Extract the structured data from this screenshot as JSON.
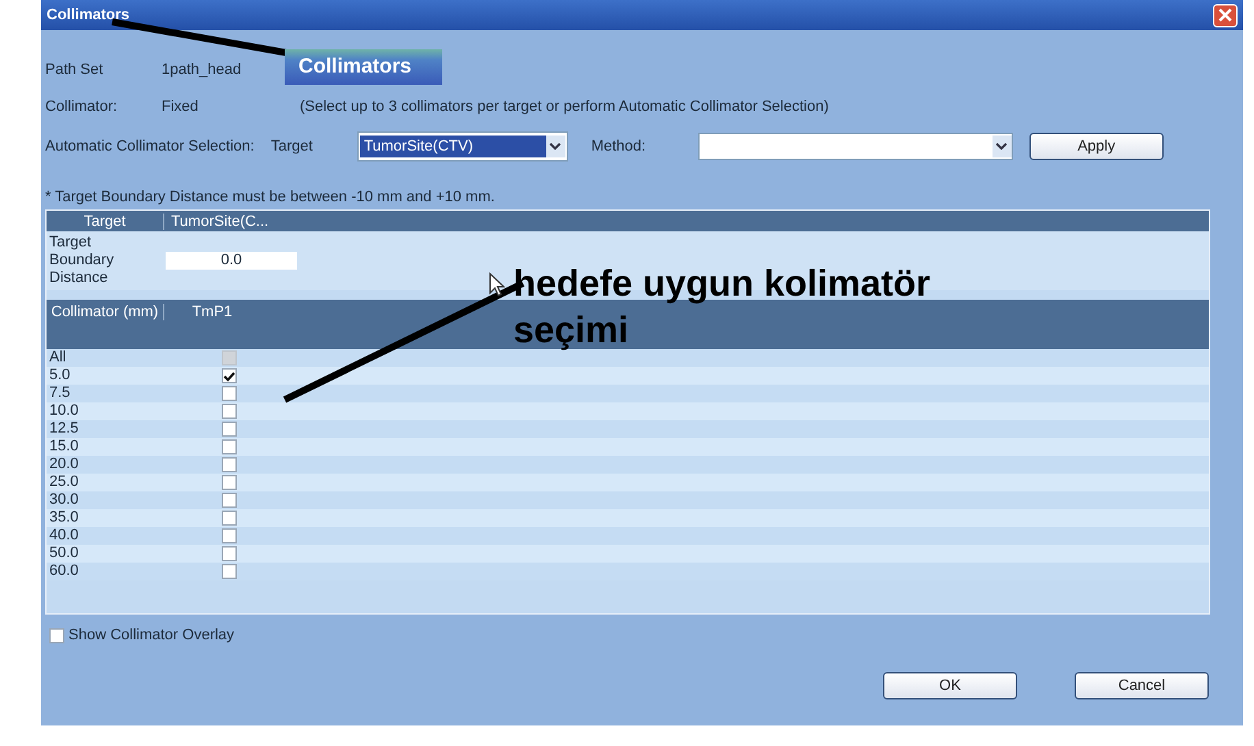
{
  "window": {
    "title": "Collimators"
  },
  "callout_label": "Collimators",
  "path_set": {
    "label": "Path Set",
    "value": "1path_head"
  },
  "collimator": {
    "label": "Collimator:",
    "value": "Fixed",
    "hint": "(Select up to 3 collimators per target or perform Automatic Collimator Selection)"
  },
  "auto_selection": {
    "label": "Automatic Collimator Selection:",
    "target_label": "Target",
    "target_value": "TumorSite(CTV)",
    "method_label": "Method:",
    "apply": "Apply"
  },
  "note": "* Target Boundary Distance must be between -10 mm and +10 mm.",
  "target_table": {
    "columns": [
      "Target",
      "TumorSite(C..."
    ],
    "row_label": "Target Boundary Distance",
    "value": "0.0"
  },
  "collimator_table": {
    "columns": [
      "Collimator (mm)",
      "TmP1"
    ],
    "rows": [
      {
        "size": "All",
        "checked": false,
        "disabled": true
      },
      {
        "size": "5.0",
        "checked": true,
        "disabled": false
      },
      {
        "size": "7.5",
        "checked": false,
        "disabled": false
      },
      {
        "size": "10.0",
        "checked": false,
        "disabled": false
      },
      {
        "size": "12.5",
        "checked": false,
        "disabled": false
      },
      {
        "size": "15.0",
        "checked": false,
        "disabled": false
      },
      {
        "size": "20.0",
        "checked": false,
        "disabled": false
      },
      {
        "size": "25.0",
        "checked": false,
        "disabled": false
      },
      {
        "size": "30.0",
        "checked": false,
        "disabled": false
      },
      {
        "size": "35.0",
        "checked": false,
        "disabled": false
      },
      {
        "size": "40.0",
        "checked": false,
        "disabled": false
      },
      {
        "size": "50.0",
        "checked": false,
        "disabled": false
      },
      {
        "size": "60.0",
        "checked": false,
        "disabled": false
      }
    ]
  },
  "show_overlay": {
    "label": "Show Collimator Overlay",
    "checked": false
  },
  "buttons": [
    "OK",
    "Cancel"
  ],
  "annotation": "hedefe uygun kolimatör seçimi"
}
